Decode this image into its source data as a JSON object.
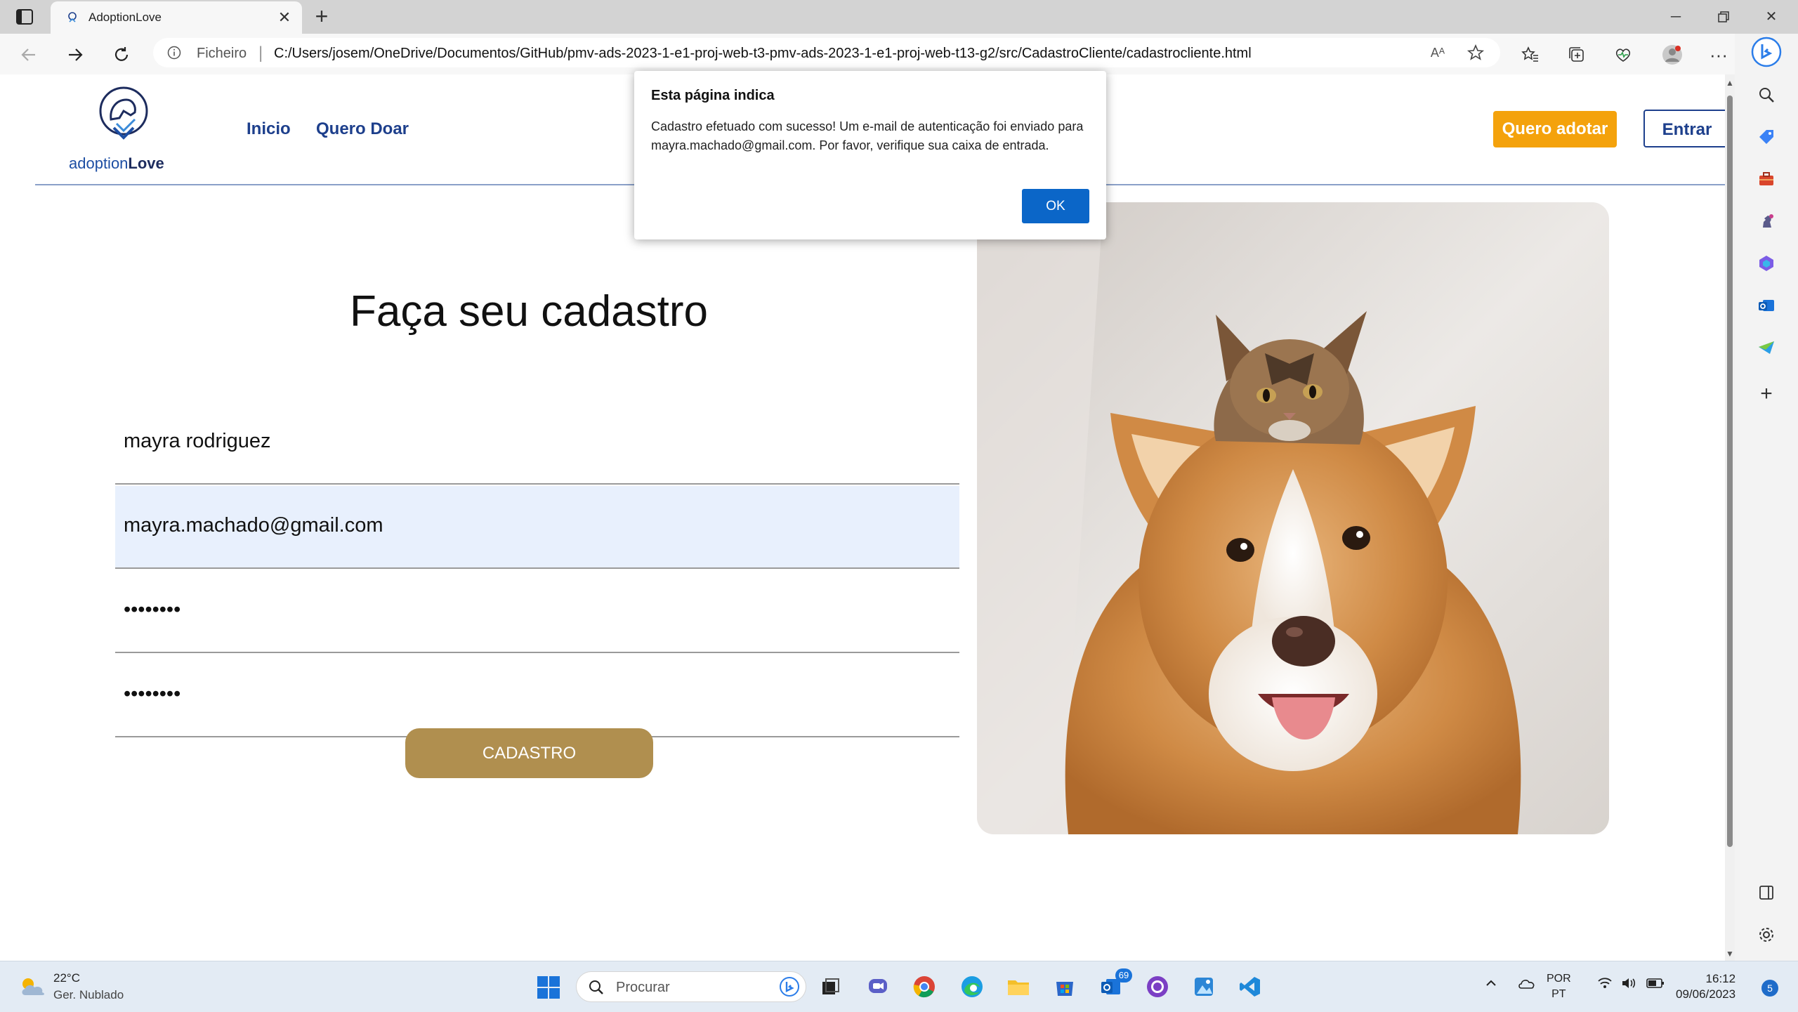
{
  "browser": {
    "tab_title": "AdoptionLove",
    "address_prefix": "Ficheiro",
    "url": "C:/Users/josem/OneDrive/Documentos/GitHub/pmv-ads-2023-1-e1-proj-web-t3-pmv-ads-2023-1-e1-proj-web-t13-g2/src/CadastroCliente/cadastrocliente.html",
    "read_aloud_label": "Aᴬ"
  },
  "site": {
    "logo_prefix": "adoption",
    "logo_suffix": "Love",
    "nav": [
      "Inicio",
      "Quero Doar"
    ],
    "btn_adopt": "Quero adotar",
    "btn_login": "Entrar"
  },
  "form": {
    "title": "Faça seu cadastro",
    "name_value": "mayra rodriguez",
    "email_value": "mayra.machado@gmail.com",
    "password_value": "••••••••",
    "confirm_value": "••••••••",
    "submit_label": "CADASTRO"
  },
  "dialog": {
    "title": "Esta página indica",
    "message": "Cadastro efetuado com sucesso! Um e-mail de autenticação foi enviado para mayra.machado@gmail.com. Por favor, verifique sua caixa de entrada.",
    "ok_label": "OK"
  },
  "taskbar": {
    "weather_temp": "22°C",
    "weather_desc": "Ger. Nublado",
    "search_placeholder": "Procurar",
    "store_badge": "69",
    "lang_line1": "POR",
    "lang_line2": "PT",
    "time": "16:12",
    "date": "09/06/2023",
    "notifications": "5"
  },
  "colors": {
    "brand_blue": "#1d3f8c",
    "adopt_orange": "#f4a20c",
    "submit_gold": "#b08f4f",
    "dialog_ok": "#0b66c8"
  }
}
